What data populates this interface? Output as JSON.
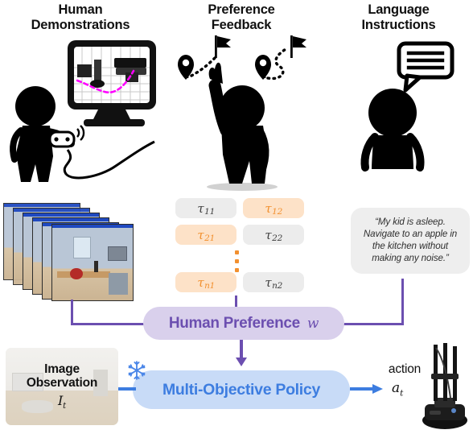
{
  "figure": {
    "columns": [
      {
        "id": "human_demonstrations",
        "title_line1": "Human",
        "title_line2": "Demonstrations",
        "illustration": "person-with-gamepad-facing-monitor-icon"
      },
      {
        "id": "preference_feedback",
        "title_line1": "Preference",
        "title_line2": "Feedback",
        "illustration": "person-pointing-at-two-routes-icon"
      },
      {
        "id": "language_instructions",
        "title_line1": "Language",
        "title_line2": "Instructions",
        "illustration": "person-with-speech-bubble-icon"
      }
    ],
    "trajectories": {
      "rows": [
        {
          "left": {
            "label": "τ",
            "sub": "11",
            "highlighted": false
          },
          "right": {
            "label": "τ",
            "sub": "12",
            "highlighted": true
          }
        },
        {
          "left": {
            "label": "τ",
            "sub": "21",
            "highlighted": true
          },
          "right": {
            "label": "τ",
            "sub": "22",
            "highlighted": false
          }
        },
        {
          "left": {
            "label": "τ",
            "sub": "n1",
            "highlighted": true
          },
          "right": {
            "label": "τ",
            "sub": "n2",
            "highlighted": false
          }
        }
      ],
      "ellipsis": "vertical-dots"
    },
    "language_instruction": "“My kid is asleep. Navigate to an apple in the kitchen without making any noise.”",
    "preference_node": {
      "label": "Human Preference",
      "symbol": "w"
    },
    "policy_node": {
      "label": "Multi-Objective Policy",
      "frozen_icon": "snowflake-icon"
    },
    "observation_node": {
      "line1": "Image",
      "line2": "Observation",
      "symbol": "I",
      "symbol_sub": "t"
    },
    "action_node": {
      "label": "action",
      "symbol": "a",
      "symbol_sub": "t",
      "robot": "mobile-robot-photo"
    },
    "colors": {
      "preference_purple": "#6c4fb0",
      "preference_fill": "#d9d0ec",
      "policy_blue": "#3d7de0",
      "policy_fill": "#c8dbf7",
      "chip_gray": "#ececec",
      "chip_orange_fill": "#fde2c8",
      "chip_orange_text": "#f2902f",
      "bubble_gray": "#eeeeee"
    }
  }
}
